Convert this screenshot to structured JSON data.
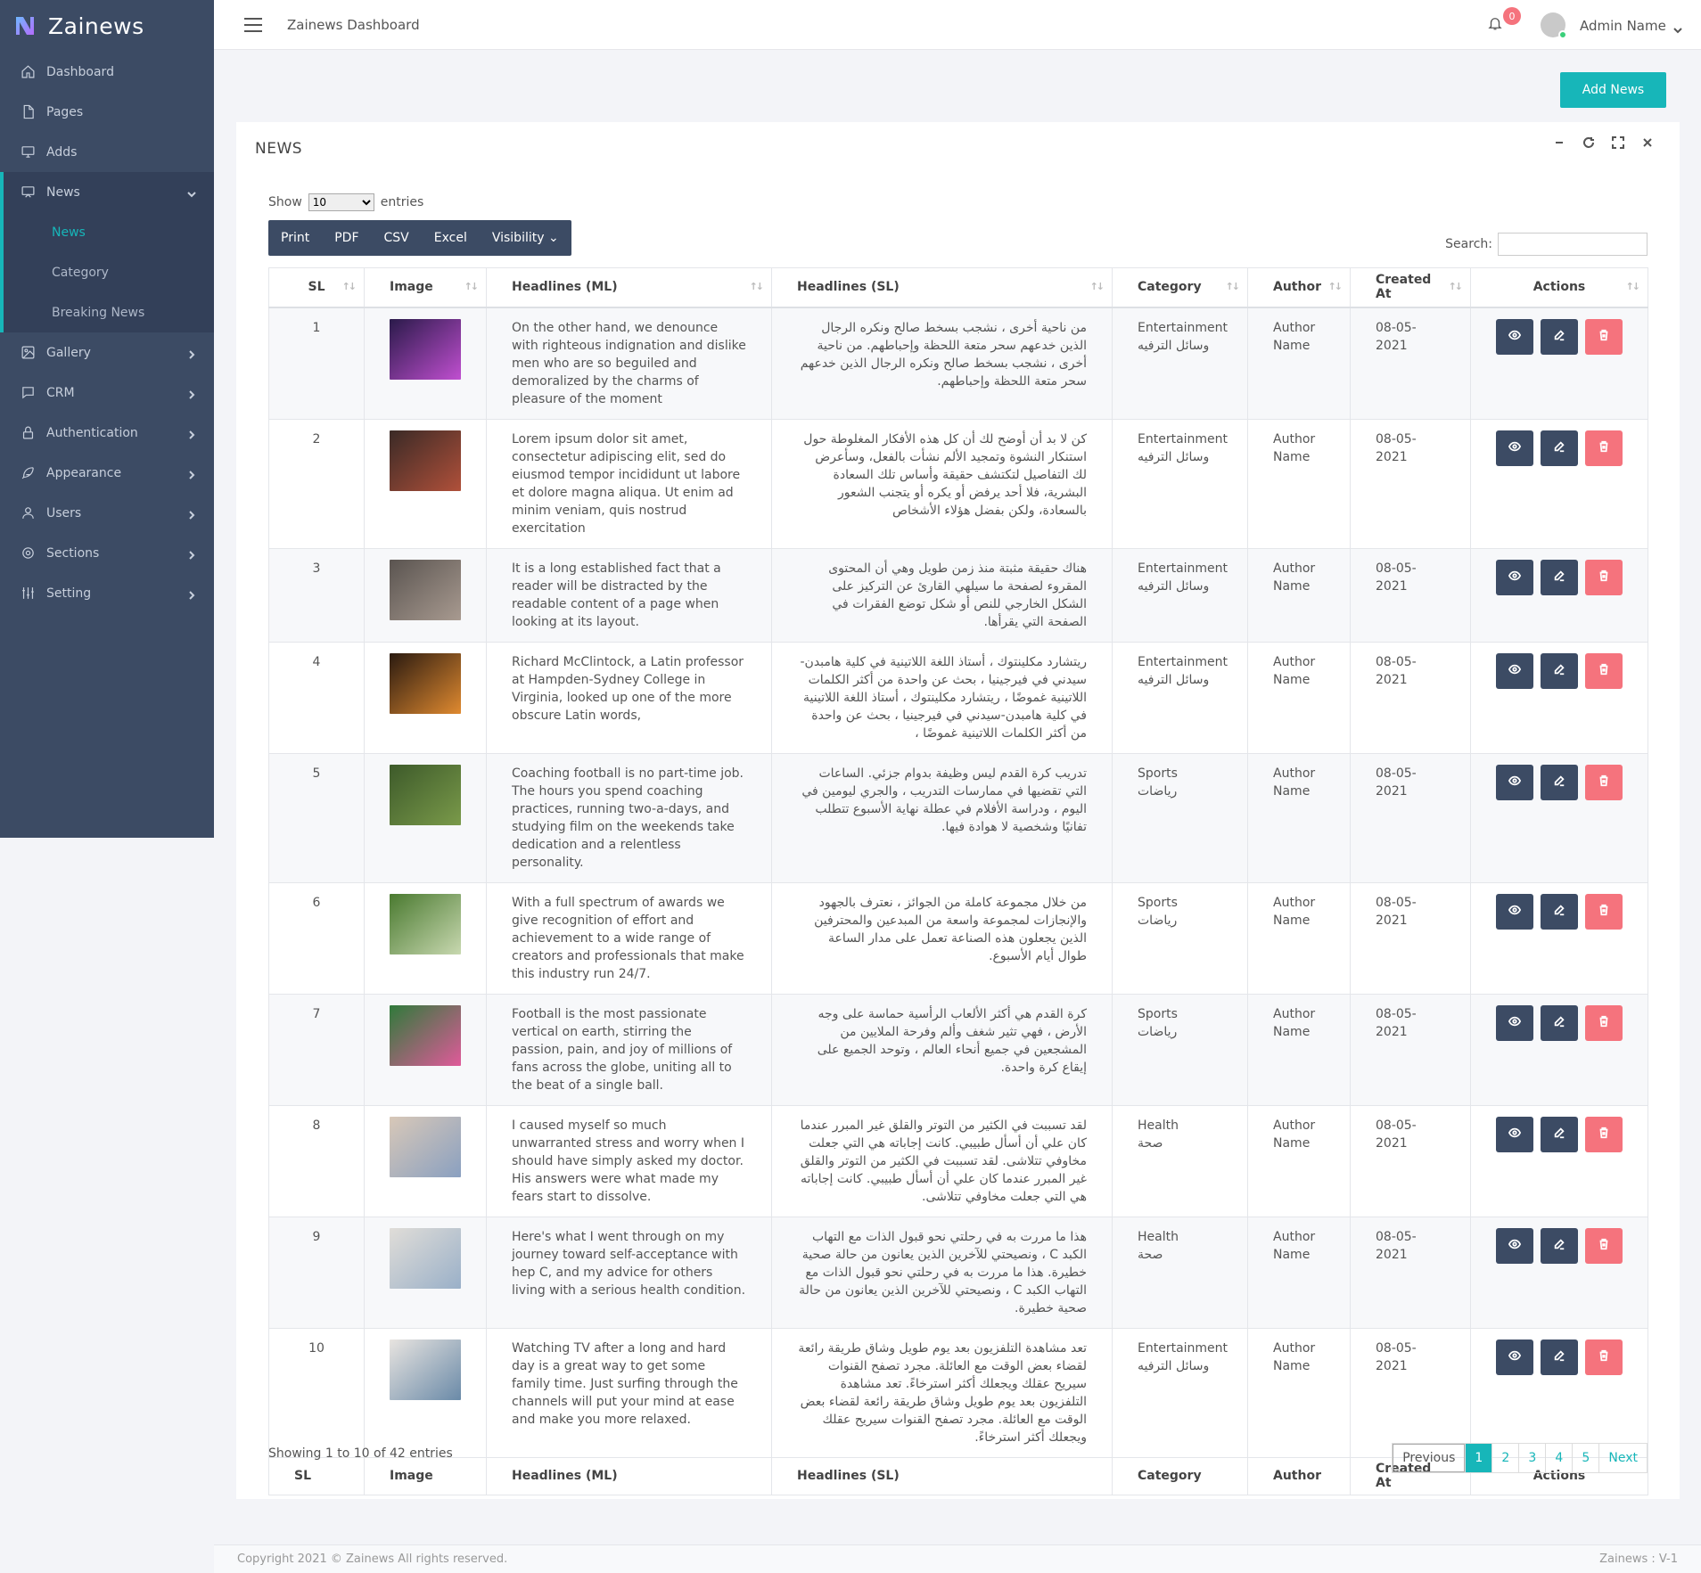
{
  "brand": {
    "name": "Zainews"
  },
  "topbar": {
    "title": "Zainews Dashboard",
    "notifications": "0",
    "user": "Admin Name"
  },
  "colors": {
    "sidebar": "#3c4b64",
    "accent": "#17b6b9",
    "danger": "#f5737d"
  },
  "sidebar": {
    "items": [
      {
        "label": "Dashboard",
        "icon": "home-icon"
      },
      {
        "label": "Pages",
        "icon": "file-icon"
      },
      {
        "label": "Adds",
        "icon": "monitor-icon"
      },
      {
        "label": "News",
        "icon": "tv-icon"
      },
      {
        "label": "Gallery",
        "icon": "image-icon"
      },
      {
        "label": "CRM",
        "icon": "message-icon"
      },
      {
        "label": "Authentication",
        "icon": "lock-icon"
      },
      {
        "label": "Appearance",
        "icon": "feather-icon"
      },
      {
        "label": "Users",
        "icon": "user-icon"
      },
      {
        "label": "Sections",
        "icon": "gear-icon"
      },
      {
        "label": "Setting",
        "icon": "sliders-icon"
      }
    ],
    "news_sub": [
      "News",
      "Category",
      "Breaking News"
    ]
  },
  "actions": {
    "add_news": "Add News"
  },
  "card": {
    "title": "NEWS",
    "show_label": "Show",
    "entries_label": "entries",
    "page_length": "10",
    "buttons": [
      "Print",
      "PDF",
      "CSV",
      "Excel",
      "Visibility"
    ],
    "search_label": "Search:",
    "info": "Showing 1 to 10 of 42 entries",
    "pagination": [
      "Previous",
      "1",
      "2",
      "3",
      "4",
      "5",
      "Next"
    ]
  },
  "table": {
    "headers": [
      "SL",
      "Image",
      "Headlines (ML)",
      "Headlines (SL)",
      "Category",
      "Author",
      "Created At",
      "Actions"
    ],
    "rows": [
      {
        "sl": "1",
        "ml": "On the other hand, we denounce with righteous indignation and dislike men who are so beguiled and demoralized by the charms of pleasure of the moment",
        "sl_text": "من ناحية أخرى ، نشجب بسخط صالح ونكره الرجال الذين خدعهم سحر متعة اللحظة وإحباطهم. من ناحية أخرى ، نشجب بسخط صالح ونكره الرجال الذين خدعهم سحر متعة اللحظة وإحباطهم.",
        "category": "Entertainment",
        "category_ar": "وسائل الترفيه",
        "author": "Author Name",
        "date": "08-05-2021",
        "img_colors": [
          "#2a1a4a",
          "#c04fd0"
        ]
      },
      {
        "sl": "2",
        "ml": "Lorem ipsum dolor sit amet, consectetur adipiscing elit, sed do eiusmod tempor incididunt ut labore et dolore magna aliqua. Ut enim ad minim veniam, quis nostrud exercitation",
        "sl_text": "كن لا بد أن أوضح لك أن كل هذه الأفكار المغلوطة حول استنكار النشوة وتمجيد الألم نشأت بالفعل، وسأعرض لك التفاصيل لتكتشف حقيقة وأساس تلك السعادة البشرية، فلا أحد يرفض أو يكره أو يتجنب الشعور بالسعادة، ولكن بفضل هؤلاء الأشخاص",
        "category": "Entertainment",
        "category_ar": "وسائل الترفيه",
        "author": "Author Name",
        "date": "08-05-2021",
        "img_colors": [
          "#3a2a26",
          "#b0503a"
        ]
      },
      {
        "sl": "3",
        "ml": "It is a long established fact that a reader will be distracted by the readable content of a page when looking at its layout.",
        "sl_text": "هناك حقيقة مثبتة منذ زمن طويل وهي أن المحتوى المقروء لصفحة ما سيلهي القارئ عن التركيز على الشكل الخارجي للنص أو شكل توضع الفقرات في الصفحة التي يقرأها.",
        "category": "Entertainment",
        "category_ar": "وسائل الترفيه",
        "author": "Author Name",
        "date": "08-05-2021",
        "img_colors": [
          "#5a5450",
          "#a89a90"
        ]
      },
      {
        "sl": "4",
        "ml": "Richard McClintock, a Latin professor at Hampden-Sydney College in Virginia, looked up one of the more obscure Latin words,",
        "sl_text": "ريتشارد مكلينتوك ، أستاذ اللغة اللاتينية في كلية هامبدن-سيدني في فيرجينيا ، بحث عن واحدة من أكثر الكلمات اللاتينية غموضًا ، ريتشارد مكلينتوك ، أستاذ اللغة اللاتينية في كلية هامبدن-سيدني في فيرجينيا ، بحث عن واحدة من أكثر الكلمات اللاتينية غموضًا ،",
        "category": "Entertainment",
        "category_ar": "وسائل الترفيه",
        "author": "Author Name",
        "date": "08-05-2021",
        "img_colors": [
          "#2a1a10",
          "#e08a30"
        ]
      },
      {
        "sl": "5",
        "ml": "Coaching football is no part-time job. The hours you spend coaching practices, running two-a-days, and studying film on the weekends take dedication and a relentless personality.",
        "sl_text": "تدريب كرة القدم ليس وظيفة بدوام جزئي. الساعات التي تقضيها في ممارسات التدريب ، والجري ليومين في اليوم ، ودراسة الأفلام في عطلة نهاية الأسبوع تتطلب تفانيًا وشخصية لا هوادة فيها.",
        "category": "Sports",
        "category_ar": "رياضات",
        "author": "Author Name",
        "date": "08-05-2021",
        "img_colors": [
          "#3d5a2a",
          "#7a9a4a"
        ]
      },
      {
        "sl": "6",
        "ml": "With a full spectrum of awards we give recognition of effort and achievement to a wide range of creators and professionals that make this industry run 24/7.",
        "sl_text": "من خلال مجموعة كاملة من الجوائز ، نعترف بالجهود والإنجازات لمجموعة واسعة من المبدعين والمحترفين الذين يجعلون هذه الصناعة تعمل على مدار الساعة طوال أيام الأسبوع.",
        "category": "Sports",
        "category_ar": "رياضات",
        "author": "Author Name",
        "date": "08-05-2021",
        "img_colors": [
          "#4a7a30",
          "#c8d8b0"
        ]
      },
      {
        "sl": "7",
        "ml": "Football is the most passionate vertical on earth, stirring the passion, pain, and joy of millions of fans across the globe, uniting all to the beat of a single ball.",
        "sl_text": "كرة القدم هي أكثر الألعاب الرأسية حماسة على وجه الأرض ، فهي تثير شغف وألم وفرحة الملايين من المشجعين في جميع أنحاء العالم ، وتوحد الجميع على إيقاع كرة واحدة.",
        "category": "Sports",
        "category_ar": "رياضات",
        "author": "Author Name",
        "date": "08-05-2021",
        "img_colors": [
          "#2f7a3a",
          "#e05a9a"
        ]
      },
      {
        "sl": "8",
        "ml": "I caused myself so much unwarranted stress and worry when I should have simply asked my doctor. His answers were what made my fears start to dissolve.",
        "sl_text": "لقد تسببت في الكثير من التوتر والقلق غير المبرر عندما كان علي أن أسأل طبيبي. كانت إجاباته هي التي جعلت مخاوفي تتلاشى. لقد تسببت في الكثير من التوتر والقلق غير المبرر عندما كان علي أن أسأل طبيبي. كانت إجاباته هي التي جعلت مخاوفي تتلاشى.",
        "category": "Health",
        "category_ar": "صحة",
        "author": "Author Name",
        "date": "08-05-2021",
        "img_colors": [
          "#d8c8b8",
          "#8aa0c0"
        ]
      },
      {
        "sl": "9",
        "ml": "Here's what I went through on my journey toward self-acceptance with hep C, and my advice for others living with a serious health condition.",
        "sl_text": "هذا ما مررت به في رحلتي نحو قبول الذات مع التهاب الكبد C ، ونصيحتي للآخرين الذين يعانون من حالة صحية خطيرة. هذا ما مررت به في رحلتي نحو قبول الذات مع التهاب الكبد C ، ونصيحتي للآخرين الذين يعانون من حالة صحية خطيرة.",
        "category": "Health",
        "category_ar": "صحة",
        "author": "Author Name",
        "date": "08-05-2021",
        "img_colors": [
          "#e0ddd8",
          "#9ab0c8"
        ]
      },
      {
        "sl": "10",
        "ml": "Watching TV after a long and hard day is a great way to get some family time. Just surfing through the channels will put your mind at ease and make you more relaxed.",
        "sl_text": "تعد مشاهدة التلفزيون بعد يوم طويل وشاق طريقة رائعة لقضاء بعض الوقت مع العائلة. مجرد تصفح القنوات سيريح عقلك ويجعلك أكثر استرخاءً. تعد مشاهدة التلفزيون بعد يوم طويل وشاق طريقة رائعة لقضاء بعض الوقت مع العائلة. مجرد تصفح القنوات سيريح عقلك ويجعلك أكثر استرخاءً.",
        "category": "Entertainment",
        "category_ar": "وسائل الترفيه",
        "author": "Author Name",
        "date": "08-05-2021",
        "img_colors": [
          "#e8e4e0",
          "#6a8aa8"
        ]
      }
    ]
  },
  "footer": {
    "copyright": "Copyright 2021 © Zainews All rights reserved.",
    "version": "Zainews : V-1"
  }
}
